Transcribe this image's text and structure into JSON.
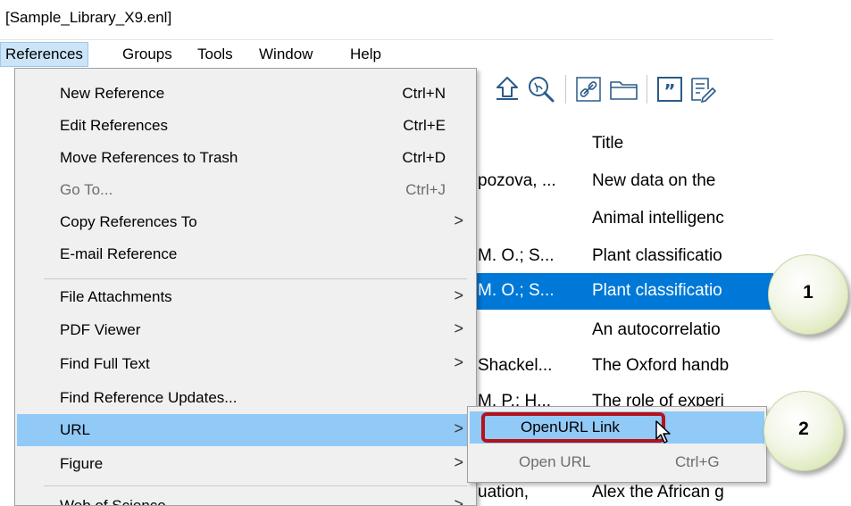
{
  "window": {
    "title": "[Sample_Library_X9.enl]"
  },
  "menubar": [
    {
      "label": "References",
      "active": true
    },
    {
      "label": "Groups"
    },
    {
      "label": "Tools"
    },
    {
      "label": "Window"
    },
    {
      "label": "Help"
    }
  ],
  "toolbar": {
    "icons": [
      "upload-icon",
      "pdf-search-icon",
      "link-icon",
      "folder-icon",
      "quote-icon",
      "edit-note-icon"
    ]
  },
  "library": {
    "column_title": "Title",
    "rows": [
      {
        "author": "pozova, ...",
        "title": "New data on the"
      },
      {
        "author": "",
        "title": "Animal intelligenc"
      },
      {
        "author": "M. O.; S...",
        "title": "Plant classificatio"
      },
      {
        "author": "M. O.; S...",
        "title": "Plant classificatio",
        "selected": true
      },
      {
        "author": "",
        "title": "An autocorrelatio"
      },
      {
        "author": "Shackel...",
        "title": "The Oxford handb"
      },
      {
        "author": "M. P.; H...",
        "title": "The role of experi"
      },
      {
        "author": "",
        "title": ""
      },
      {
        "author": "",
        "title": ""
      },
      {
        "author": "uation,",
        "title": "Alex the African g"
      }
    ]
  },
  "references_menu": {
    "items": [
      {
        "label": "New Reference",
        "shortcut": "Ctrl+N"
      },
      {
        "label": "Edit References",
        "shortcut": "Ctrl+E"
      },
      {
        "label": "Move References to Trash",
        "shortcut": "Ctrl+D"
      },
      {
        "label": "Go To...",
        "shortcut": "Ctrl+J",
        "disabled": true
      },
      {
        "label": "Copy References To",
        "submenu": ">"
      },
      {
        "label": "E-mail Reference"
      },
      {
        "label": "File Attachments",
        "submenu": ">"
      },
      {
        "label": "PDF Viewer",
        "submenu": ">"
      },
      {
        "label": "Find Full Text",
        "submenu": ">"
      },
      {
        "label": "Find Reference Updates..."
      },
      {
        "label": "URL",
        "submenu": ">",
        "highlighted": true
      },
      {
        "label": "Figure",
        "submenu": ">"
      },
      {
        "label": "Web of Science",
        "submenu": ">"
      }
    ]
  },
  "url_submenu": {
    "items": [
      {
        "label": "OpenURL Link",
        "highlighted": true
      },
      {
        "label": "Open URL",
        "shortcut": "Ctrl+G",
        "disabled": true
      }
    ]
  },
  "callouts": [
    {
      "label": "1"
    },
    {
      "label": "2"
    }
  ],
  "colors": {
    "selection": "#0078d7",
    "menu_highlight": "#91c9f7",
    "callout_outline": "#b5121b",
    "badge_fill": "#dbe8b8"
  }
}
